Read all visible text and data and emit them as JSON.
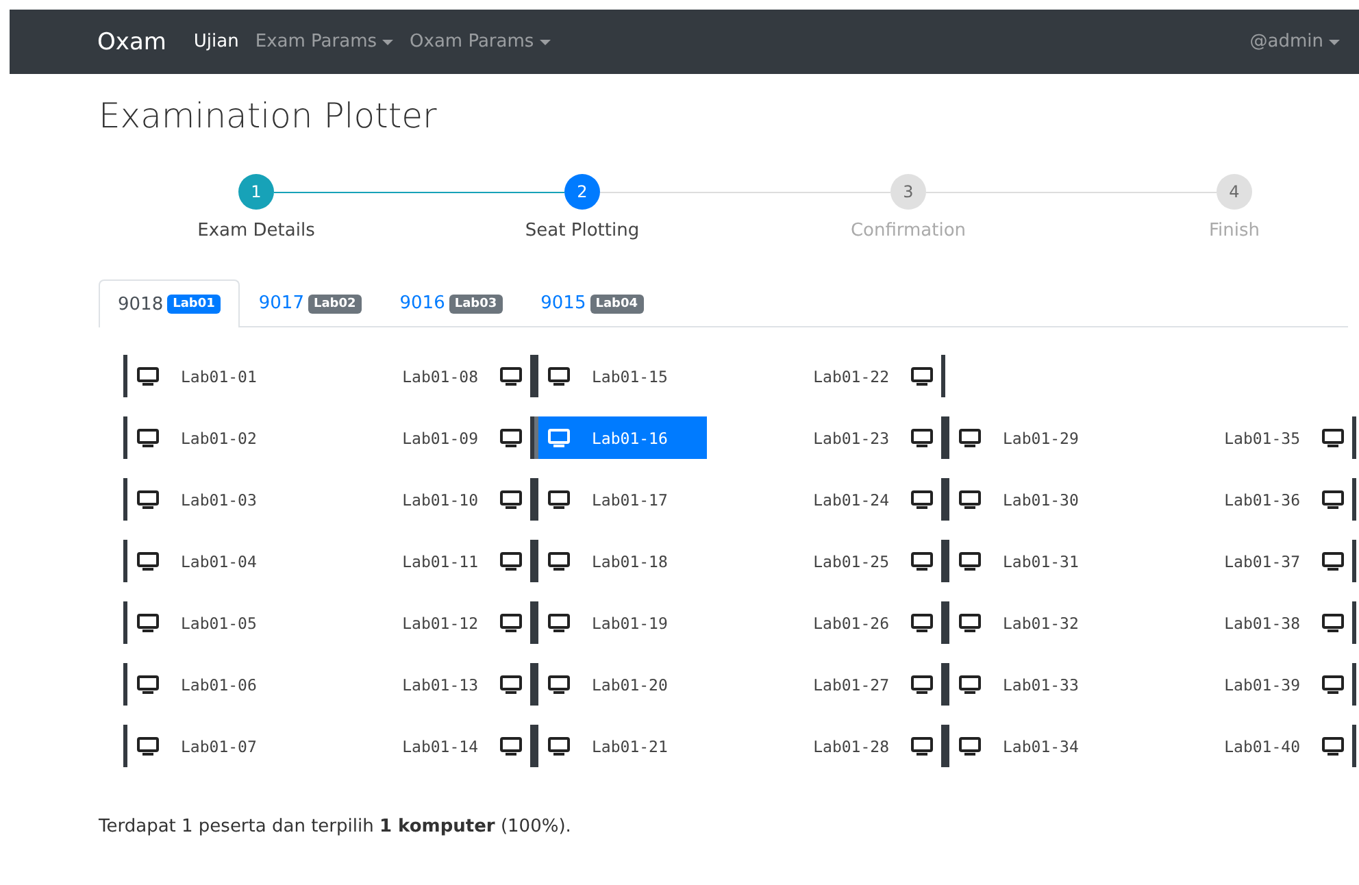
{
  "navbar": {
    "brand": "Oxam",
    "items": [
      {
        "label": "Ujian",
        "selected": true,
        "dropdown": false
      },
      {
        "label": "Exam Params",
        "selected": false,
        "dropdown": true
      },
      {
        "label": "Oxam Params",
        "selected": false,
        "dropdown": true
      }
    ],
    "user": "@admin"
  },
  "page_title": "Examination Plotter",
  "steps": [
    {
      "number": "1",
      "label": "Exam Details",
      "completed": true,
      "current": false
    },
    {
      "number": "2",
      "label": "Seat Plotting",
      "completed": false,
      "current": true
    },
    {
      "number": "3",
      "label": "Confirmation",
      "completed": false,
      "current": false
    },
    {
      "number": "4",
      "label": "Finish",
      "completed": false,
      "current": false
    }
  ],
  "tabs": [
    {
      "label": "9018",
      "badge": "Lab01",
      "selected": true
    },
    {
      "label": "9017",
      "badge": "Lab02",
      "selected": false
    },
    {
      "label": "9016",
      "badge": "Lab03",
      "selected": false
    },
    {
      "label": "9015",
      "badge": "Lab04",
      "selected": false
    }
  ],
  "seat_groups": [
    {
      "rows": [
        {
          "left": {
            "label": "Lab01-01",
            "selected": false
          },
          "right": {
            "label": "Lab01-08",
            "selected": false
          }
        },
        {
          "left": {
            "label": "Lab01-02",
            "selected": false
          },
          "right": {
            "label": "Lab01-09",
            "selected": false
          }
        },
        {
          "left": {
            "label": "Lab01-03",
            "selected": false
          },
          "right": {
            "label": "Lab01-10",
            "selected": false
          }
        },
        {
          "left": {
            "label": "Lab01-04",
            "selected": false
          },
          "right": {
            "label": "Lab01-11",
            "selected": false
          }
        },
        {
          "left": {
            "label": "Lab01-05",
            "selected": false
          },
          "right": {
            "label": "Lab01-12",
            "selected": false
          }
        },
        {
          "left": {
            "label": "Lab01-06",
            "selected": false
          },
          "right": {
            "label": "Lab01-13",
            "selected": false
          }
        },
        {
          "left": {
            "label": "Lab01-07",
            "selected": false
          },
          "right": {
            "label": "Lab01-14",
            "selected": false
          }
        }
      ]
    },
    {
      "rows": [
        {
          "left": {
            "label": "Lab01-15",
            "selected": false
          },
          "right": {
            "label": "Lab01-22",
            "selected": false
          }
        },
        {
          "left": {
            "label": "Lab01-16",
            "selected": true
          },
          "right": {
            "label": "Lab01-23",
            "selected": false
          }
        },
        {
          "left": {
            "label": "Lab01-17",
            "selected": false
          },
          "right": {
            "label": "Lab01-24",
            "selected": false
          }
        },
        {
          "left": {
            "label": "Lab01-18",
            "selected": false
          },
          "right": {
            "label": "Lab01-25",
            "selected": false
          }
        },
        {
          "left": {
            "label": "Lab01-19",
            "selected": false
          },
          "right": {
            "label": "Lab01-26",
            "selected": false
          }
        },
        {
          "left": {
            "label": "Lab01-20",
            "selected": false
          },
          "right": {
            "label": "Lab01-27",
            "selected": false
          }
        },
        {
          "left": {
            "label": "Lab01-21",
            "selected": false
          },
          "right": {
            "label": "Lab01-28",
            "selected": false
          }
        }
      ]
    },
    {
      "rows": [
        {},
        {
          "left": {
            "label": "Lab01-29",
            "selected": false
          },
          "right": {
            "label": "Lab01-35",
            "selected": false
          }
        },
        {
          "left": {
            "label": "Lab01-30",
            "selected": false
          },
          "right": {
            "label": "Lab01-36",
            "selected": false
          }
        },
        {
          "left": {
            "label": "Lab01-31",
            "selected": false
          },
          "right": {
            "label": "Lab01-37",
            "selected": false
          }
        },
        {
          "left": {
            "label": "Lab01-32",
            "selected": false
          },
          "right": {
            "label": "Lab01-38",
            "selected": false
          }
        },
        {
          "left": {
            "label": "Lab01-33",
            "selected": false
          },
          "right": {
            "label": "Lab01-39",
            "selected": false
          }
        },
        {
          "left": {
            "label": "Lab01-34",
            "selected": false
          },
          "right": {
            "label": "Lab01-40",
            "selected": false
          }
        }
      ]
    }
  ],
  "summary": "Terdapat 1 peserta dan terpilih **1 komputer** (100%)."
}
